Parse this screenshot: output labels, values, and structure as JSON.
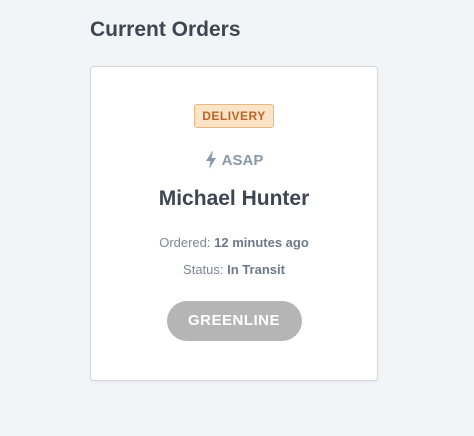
{
  "page": {
    "title": "Current Orders"
  },
  "order": {
    "type_badge": "DELIVERY",
    "timing": "ASAP",
    "timing_icon": "bolt-icon",
    "customer_name": "Michael Hunter",
    "ordered_label": "Ordered:",
    "ordered_value": "12 minutes ago",
    "status_label": "Status:",
    "status_value": "In Transit",
    "restaurant_button": "GREENLINE"
  },
  "colors": {
    "background": "#f2f5f8",
    "badge_bg": "#fbe3c6",
    "badge_text": "#c0632a",
    "badge_border": "#e7b886",
    "muted_text": "#8b98a8",
    "heading_text": "#3e4652",
    "button_bg": "#b5b5b5"
  }
}
